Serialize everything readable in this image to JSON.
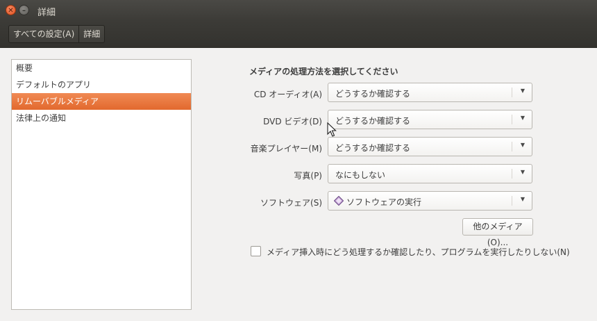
{
  "window": {
    "title": "詳細"
  },
  "toolbar": {
    "crumbs": [
      "すべての設定(A)",
      "詳細"
    ]
  },
  "sidebar": {
    "items": [
      {
        "label": "概要",
        "selected": false
      },
      {
        "label": "デフォルトのアプリ",
        "selected": false
      },
      {
        "label": "リムーバブルメディア",
        "selected": true
      },
      {
        "label": "法律上の通知",
        "selected": false
      }
    ]
  },
  "main": {
    "title": "メディアの処理方法を選択してください",
    "rows": [
      {
        "label": "CD オーディオ(A)",
        "value": "どうするか確認する"
      },
      {
        "label": "DVD ビデオ(D)",
        "value": "どうするか確認する"
      },
      {
        "label": "音楽プレイヤー(M)",
        "value": "どうするか確認する"
      },
      {
        "label": "写真(P)",
        "value": "なにもしない"
      },
      {
        "label": "ソフトウェア(S)",
        "value": "ソフトウェアの実行",
        "icon": "software-icon"
      }
    ],
    "other_media_button": "他のメディア(O)...",
    "never_prompt_checkbox": {
      "label": "メディア挿入時にどう処理するか確認したり、プログラムを実行したりしない(N)",
      "checked": false
    }
  },
  "colors": {
    "accent": "#e9743a",
    "titlebar": "#3c3b37",
    "close": "#e0501f"
  }
}
